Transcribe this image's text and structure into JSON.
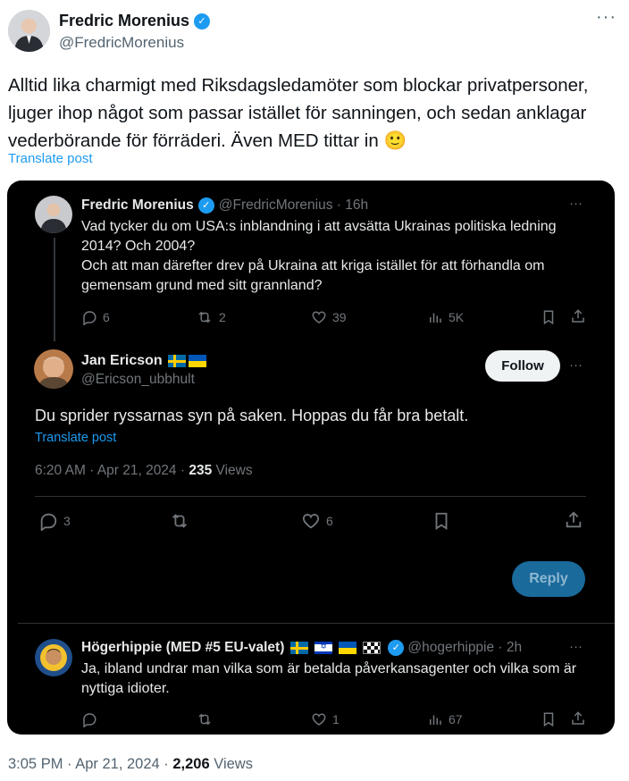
{
  "outer": {
    "author_name": "Fredric Morenius",
    "handle": "@FredricMorenius",
    "more": "···",
    "text": "Alltid lika charmigt med Riksdagsledamöter som blockar privatpersoner, ljuger ihop något som passar istället för sanningen, och sedan anklagar vederbörande för förräderi. Även MED tittar in 🙂",
    "translate": "Translate post",
    "time": "3:05 PM · Apr 21, 2024 · ",
    "views_count": "2,206",
    "views_label": " Views"
  },
  "parent_tweet": {
    "author_name": "Fredric Morenius",
    "handle_time": "@FredricMorenius · 16h",
    "more": "···",
    "text": "Vad tycker du om USA:s inblandning i att avsätta Ukrainas politiska ledning 2014? Och 2004?\nOch att man därefter drev på Ukraina att kriga istället för att förhandla om gemensam grund med sitt grannland?",
    "replies": "6",
    "retweets": "2",
    "likes": "39",
    "views": "5K"
  },
  "main_tweet": {
    "author_name": "Jan Ericson",
    "handle": "@Ericson_ubbhult",
    "follow_label": "Follow",
    "more": "···",
    "text": "Du sprider ryssarnas syn på saken. Hoppas du får bra betalt.",
    "translate": "Translate post",
    "time": "6:20 AM · Apr 21, 2024 · ",
    "views_count": "235",
    "views_label": " Views",
    "replies": "3",
    "likes": "6",
    "reply_button": "Reply"
  },
  "reply_tweet": {
    "author_name": "Högerhippie (MED #5 EU-valet)",
    "handle_time": "@hogerhippie · 2h",
    "more": "···",
    "text": "Ja, ibland undrar man vilka som är betalda påverkansagenter och vilka som är nyttiga idioter.",
    "likes": "1",
    "views": "67"
  },
  "colors": {
    "accent": "#1d9bf0",
    "card_bg": "#000000",
    "text_light": "#e7e9ea",
    "text_dim": "#71767b"
  }
}
